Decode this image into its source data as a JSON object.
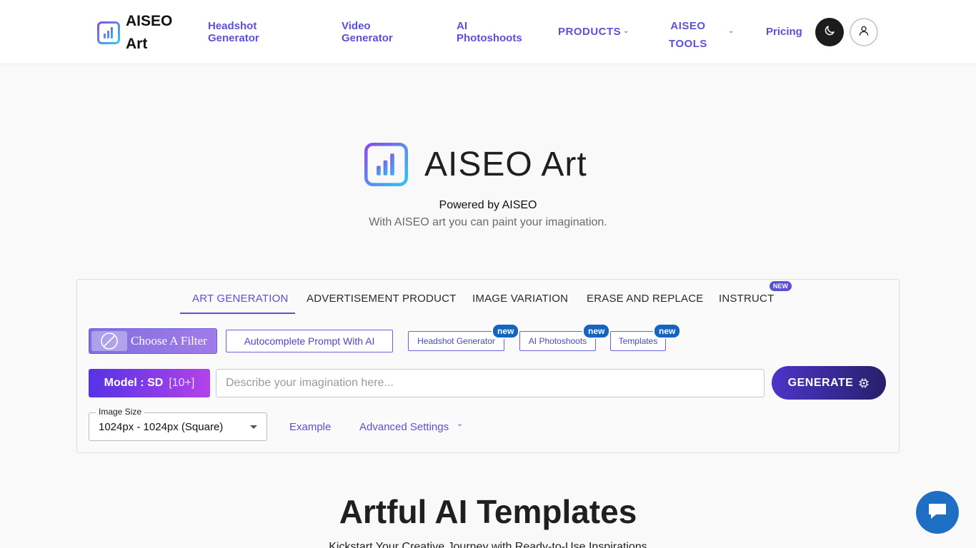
{
  "header": {
    "brand": "AISEO Art",
    "nav": {
      "headshot": "Headshot Generator",
      "video": "Video Generator",
      "photoshoots": "AI Photoshoots",
      "products": "PRODUCTS",
      "tools": "AISEO TOOLS",
      "pricing": "Pricing"
    },
    "icons": {
      "theme": "moon-icon",
      "account": "user-icon"
    }
  },
  "hero": {
    "title": "AISEO Art",
    "powered_by": "Powered by AISEO",
    "tagline": "With AISEO art you can paint your imagination."
  },
  "panel": {
    "tabs": [
      {
        "label": "ART GENERATION",
        "active": true
      },
      {
        "label": "ADVERTISEMENT PRODUCT",
        "active": false
      },
      {
        "label": "IMAGE VARIATION",
        "active": false
      },
      {
        "label": "ERASE AND REPLACE",
        "active": false
      },
      {
        "label": "INSTRUCT",
        "active": false,
        "badge": "NEW"
      }
    ],
    "filter_label": "Choose A Filter",
    "autocomplete_label": "Autocomplete Prompt With AI",
    "quick_links": [
      {
        "label": "Headshot Generator",
        "badge": "new"
      },
      {
        "label": "AI Photoshoots",
        "badge": "new"
      },
      {
        "label": "Templates",
        "badge": "new"
      }
    ],
    "model": {
      "label": "Model : SD",
      "count": "[10+]"
    },
    "prompt": {
      "placeholder": "Describe your imagination here...",
      "value": ""
    },
    "generate_label": "GENERATE",
    "image_size": {
      "legend": "Image Size",
      "value": "1024px - 1024px (Square)"
    },
    "example_label": "Example",
    "advanced_label": "Advanced Settings"
  },
  "section": {
    "title": "Artful AI Templates",
    "subtitle": "Kickstart Your Creative Journey with Ready-to-Use Inspirations"
  },
  "colors": {
    "accent": "#5b50d6",
    "chat": "#1e6fc4"
  }
}
